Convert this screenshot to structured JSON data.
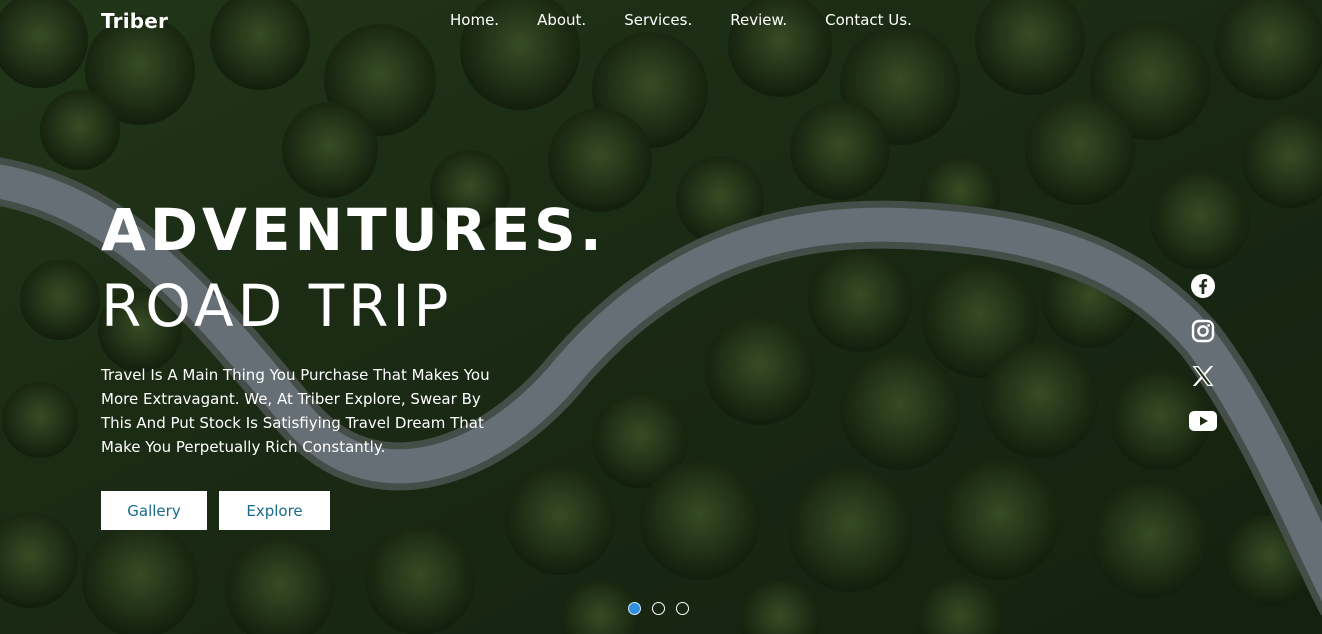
{
  "brand": {
    "logo": "Triber"
  },
  "nav": {
    "items": [
      {
        "label": "Home."
      },
      {
        "label": "About."
      },
      {
        "label": "Services."
      },
      {
        "label": "Review."
      },
      {
        "label": "Contact Us."
      }
    ]
  },
  "hero": {
    "headline": "ADVENTURES.",
    "subline": "ROAD TRIP",
    "description": "Travel Is A Main Thing You Purchase That Makes You More Extravagant. We, At Triber Explore, Swear By This And Put Stock Is Satisfiying Travel Dream That Make You Perpetually Rich Constantly.",
    "buttons": {
      "gallery": "Gallery",
      "explore": "Explore"
    }
  },
  "social": {
    "icons": [
      "facebook-icon",
      "instagram-icon",
      "x-icon",
      "youtube-icon"
    ]
  },
  "carousel": {
    "slides": 3,
    "active_index": 0
  },
  "colors": {
    "button_text": "#1b6b8f",
    "active_dot": "#2f8ee0",
    "forest": "#2b4220",
    "road": "#8e9aa3"
  }
}
